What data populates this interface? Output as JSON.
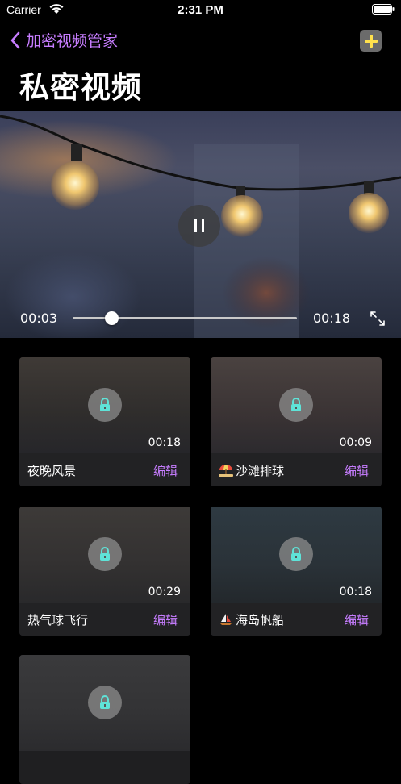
{
  "status_bar": {
    "carrier": "Carrier",
    "time": "2:31 PM"
  },
  "nav": {
    "back_label": "加密视频管家",
    "back_icon": "chevron-left-icon",
    "add_icon": "plus-icon"
  },
  "page": {
    "title": "私密视频"
  },
  "player": {
    "current_time": "00:03",
    "duration": "00:18",
    "progress": 0.17,
    "state": "playing"
  },
  "videos": [
    {
      "name": "夜晚风景",
      "duration": "00:18",
      "edit_label": "编辑",
      "emoji": ""
    },
    {
      "name": "沙滩排球",
      "duration": "00:09",
      "edit_label": "编辑",
      "emoji": "beach-umbrella-icon"
    },
    {
      "name": "热气球飞行",
      "duration": "00:29",
      "edit_label": "编辑",
      "emoji": ""
    },
    {
      "name": "海岛帆船",
      "duration": "00:18",
      "edit_label": "编辑",
      "emoji": "sailboat-icon"
    },
    {
      "name": "",
      "duration": "",
      "edit_label": "",
      "emoji": ""
    }
  ],
  "colors": {
    "accent": "#c77dff",
    "lock_icon": "#5fe3d8",
    "add_plus": "#ffe14d"
  }
}
